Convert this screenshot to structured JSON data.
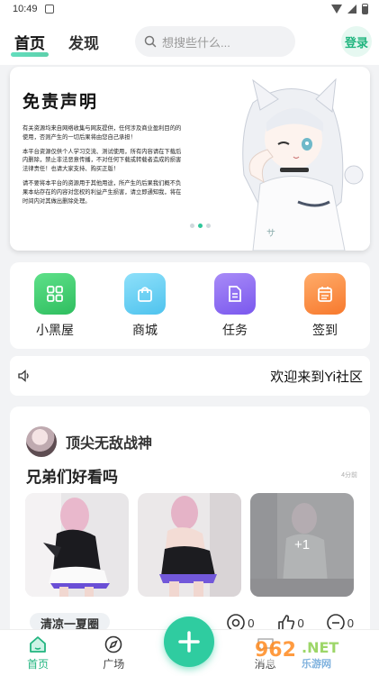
{
  "status_bar": {
    "time": "10:49"
  },
  "header": {
    "tabs": [
      {
        "label": "首页"
      },
      {
        "label": "发现"
      }
    ],
    "search_placeholder": "想搜些什么...",
    "login_label": "登录"
  },
  "banner": {
    "title": "免责声明",
    "paragraphs": [
      "有关资源均来自网络收集与网友提供，任何涉及商业盈利目的的均不得使用，否则产生的一切后果将由您自己承担！",
      "本平台资源仅供个人学习交流、测试使用，所有内容请在下载后24小时内删除，禁止非法恶意传播，不对任何下载或转载者造成的损害负任何法律责任！也请大家支持、购买正版！",
      "请不要将本平台的资源用于其他用途，所产生的后果我们概不负责！如果本站存在的内容对您权的利益产生损害，请立即通知我，将在最短的时间内对其做出删除处理。"
    ],
    "active_dot": 1
  },
  "quick_entries": [
    {
      "label": "小黑屋",
      "icon": "grid-icon",
      "color": "#3ecf6a"
    },
    {
      "label": "商城",
      "icon": "bag-icon",
      "color": "#6fcff2"
    },
    {
      "label": "任务",
      "icon": "document-icon",
      "color": "#8b6ff2"
    },
    {
      "label": "签到",
      "icon": "calendar-icon",
      "color": "#fb8c3c"
    }
  ],
  "notice": {
    "icon": "speaker-icon",
    "text": "欢迎来到Yi社区"
  },
  "post": {
    "author": "顶尖无敌战神",
    "title": "兄弟们好看吗",
    "time": "4分前",
    "extra_images": "+1",
    "tag": "清凉一夏圈",
    "likes": "0",
    "views": "0",
    "comments": "0"
  },
  "bottom_nav": [
    {
      "label": "首页",
      "icon": "home-icon"
    },
    {
      "label": "广场",
      "icon": "compass-icon"
    },
    {
      "label": "消息",
      "icon": "message-icon"
    }
  ],
  "colors": {
    "accent": "#2fcca0",
    "accent_text": "#21b57f"
  }
}
